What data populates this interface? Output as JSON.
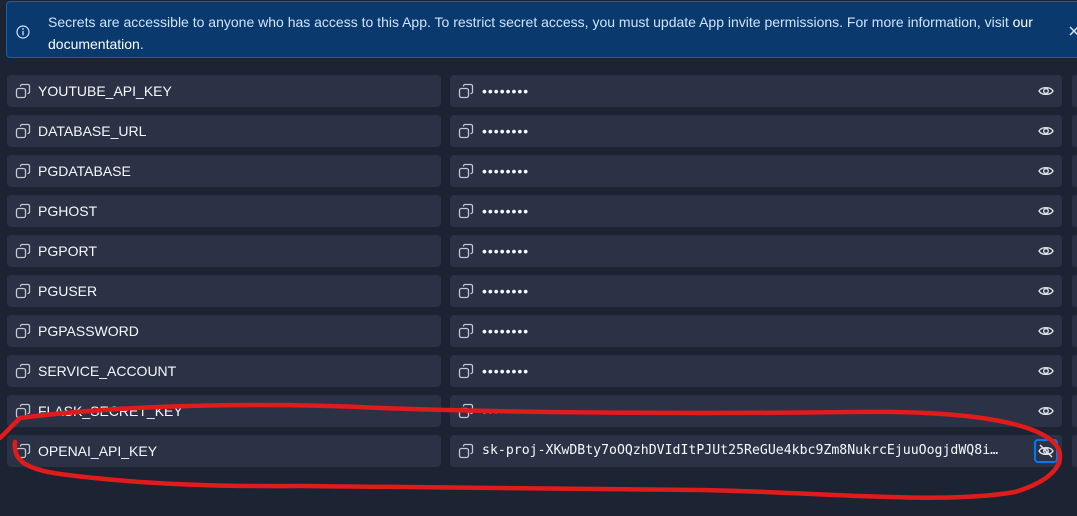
{
  "banner": {
    "message": "Secrets are accessible to anyone who has access to this App. To restrict secret access, you must update App invite permissions. For more information, visit ",
    "link_text": "our documentation",
    "period": ".",
    "icon": "info-icon",
    "close_icon": "close-icon"
  },
  "secrets": [
    {
      "key": "YOUTUBE_API_KEY",
      "value": "••••••••",
      "revealed": false
    },
    {
      "key": "DATABASE_URL",
      "value": "••••••••",
      "revealed": false
    },
    {
      "key": "PGDATABASE",
      "value": "••••••••",
      "revealed": false
    },
    {
      "key": "PGHOST",
      "value": "••••••••",
      "revealed": false
    },
    {
      "key": "PGPORT",
      "value": "••••••••",
      "revealed": false
    },
    {
      "key": "PGUSER",
      "value": "••••••••",
      "revealed": false
    },
    {
      "key": "PGPASSWORD",
      "value": "••••••••",
      "revealed": false
    },
    {
      "key": "SERVICE_ACCOUNT",
      "value": "••••••••",
      "revealed": false
    },
    {
      "key": "FLASK_SECRET_KEY",
      "value": "••••••••",
      "revealed": false
    },
    {
      "key": "OPENAI_API_KEY",
      "value": "sk-proj-XKwDBty7oOQzhDVIdItPJUt25ReGUe4kbc9Zm8NukrcEjuuOogjdWQ8i…",
      "revealed": true
    }
  ],
  "colors": {
    "background": "#1c2333",
    "field": "#2b3245",
    "banner_bg": "#0a3a6d",
    "banner_border": "#0e62b8",
    "focus": "#0079f2",
    "annotation": "#e01b1b"
  }
}
